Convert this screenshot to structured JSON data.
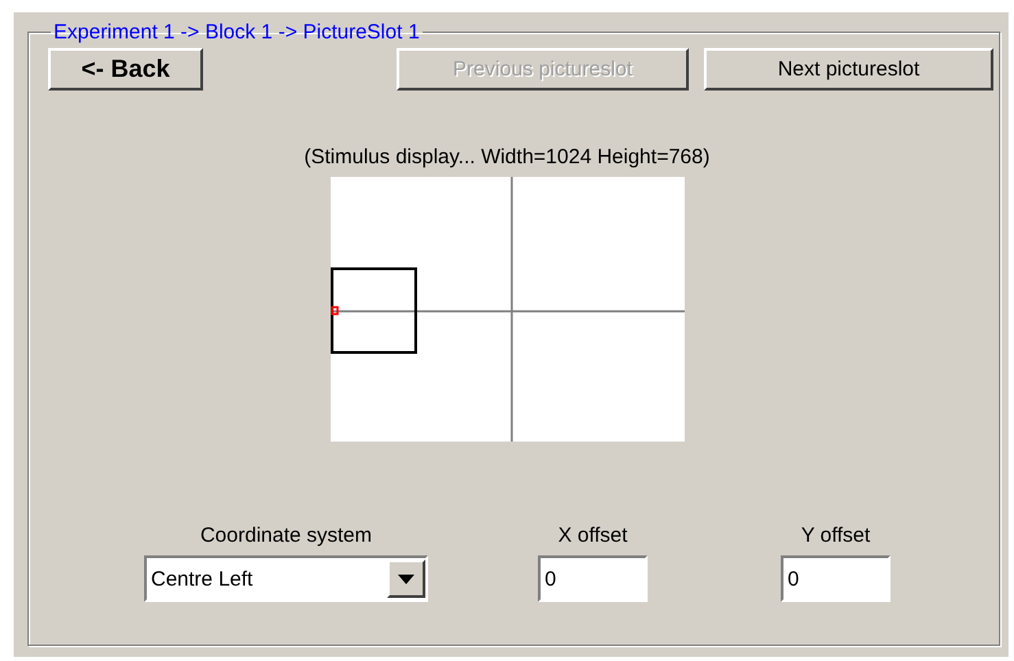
{
  "group": {
    "title": "Experiment 1 -> Block 1 -> PictureSlot 1"
  },
  "buttons": [
    {
      "kind": "back",
      "label": "<- Back",
      "disabled": false
    },
    {
      "kind": "nav",
      "label": "Previous pictureslot",
      "disabled": true
    },
    {
      "kind": "nav",
      "label": "Next pictureslot",
      "disabled": false
    }
  ],
  "display_label": "(Stimulus display... Width=1024 Height=768)",
  "fields": [
    {
      "kind": "combo",
      "label": "Coordinate system",
      "value": "Centre Left"
    },
    {
      "kind": "text",
      "label": "X offset",
      "value": "0"
    },
    {
      "kind": "text",
      "label": "Y offset",
      "value": "0"
    }
  ]
}
